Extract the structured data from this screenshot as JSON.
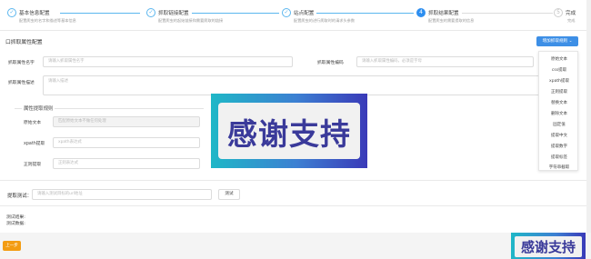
{
  "steps": [
    {
      "number": "✓",
      "title": "基本信息配置",
      "desc": "配置爬虫的名字和描述等基本信息",
      "state": "done"
    },
    {
      "number": "✓",
      "title": "抓取链接配置",
      "desc": "配置爬虫的起始链接和需要爬取的链接",
      "state": "done"
    },
    {
      "number": "✓",
      "title": "站点配置",
      "desc": "配置爬虫的进行爬取时的请求头参数",
      "state": "done"
    },
    {
      "number": "4",
      "title": "抓取结果配置",
      "desc": "配置爬虫的需要提取的信息",
      "state": "active"
    },
    {
      "number": "5",
      "title": "完成",
      "desc": "完成",
      "state": "todo"
    }
  ],
  "section": {
    "title": "口抓取属性配置",
    "add_rule_label": "增加抓取规则 ⌄"
  },
  "rule_menu": [
    "原始文本",
    "css提取",
    "xpath提取",
    "正则提取",
    "替换文本",
    "删除文本",
    "固定值",
    "提取中文",
    "提取数字",
    "提取标签",
    "字符串截取"
  ],
  "form": {
    "attr_name_label": "抓取属性名字",
    "attr_name_placeholder": "请输入抓取属性名字",
    "attr_code_label": "抓取属性编码",
    "attr_code_placeholder": "请输入抓取属性编码，必须是字母",
    "attr_desc_label": "抓取属性描述",
    "attr_desc_placeholder": "请输入描述"
  },
  "rules": {
    "legend": "属性提取规则",
    "original_label": "原始文本",
    "original_placeholder": "匹配原始文本不做任何处理",
    "xpath_label": "xpath提取",
    "xpath_placeholder": "xpath表达式",
    "regex_label": "正则提取",
    "regex_placeholder": "正则表达式"
  },
  "test": {
    "label": "提取测试：",
    "placeholder": "请输入测试目标的url地址",
    "button": "测试",
    "result_label": "测试结果:",
    "data_label": "测试数据:"
  },
  "footer": {
    "prev_button": "上一步"
  },
  "overlay": {
    "banner_text": "感谢支持"
  },
  "colors": {
    "accent": "#3d8fe6",
    "step_done": "#5bb6ee",
    "warning": "#f39c12"
  }
}
